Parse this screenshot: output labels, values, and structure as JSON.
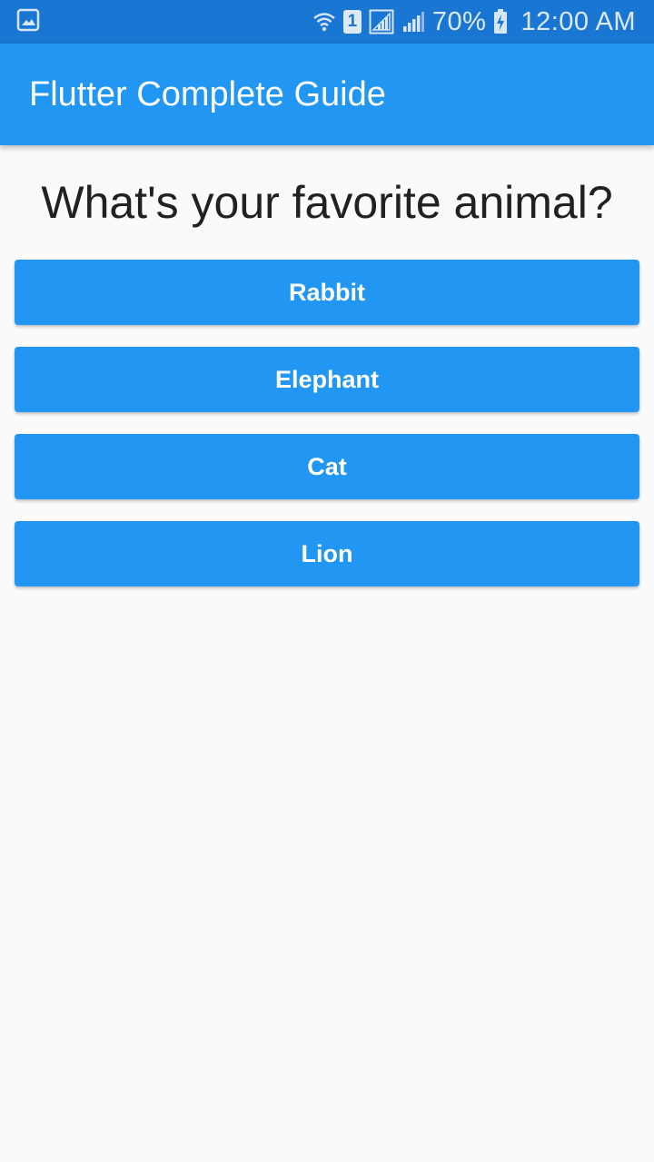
{
  "status_bar": {
    "icons": [
      "gallery-icon",
      "wifi-icon",
      "sim-1-icon",
      "signal-icon",
      "signal-icon",
      "battery-charging-icon"
    ],
    "sim_label": "1",
    "battery_percent": "70%",
    "time": "12:00 AM"
  },
  "app_bar": {
    "title": "Flutter Complete Guide"
  },
  "question": {
    "text": "What's your favorite animal?"
  },
  "answers": [
    {
      "label": "Rabbit"
    },
    {
      "label": "Elephant"
    },
    {
      "label": "Cat"
    },
    {
      "label": "Lion"
    }
  ],
  "colors": {
    "primary": "#2196f3",
    "status_bar": "#1976d2",
    "background": "#fafafa",
    "text": "#212121"
  }
}
